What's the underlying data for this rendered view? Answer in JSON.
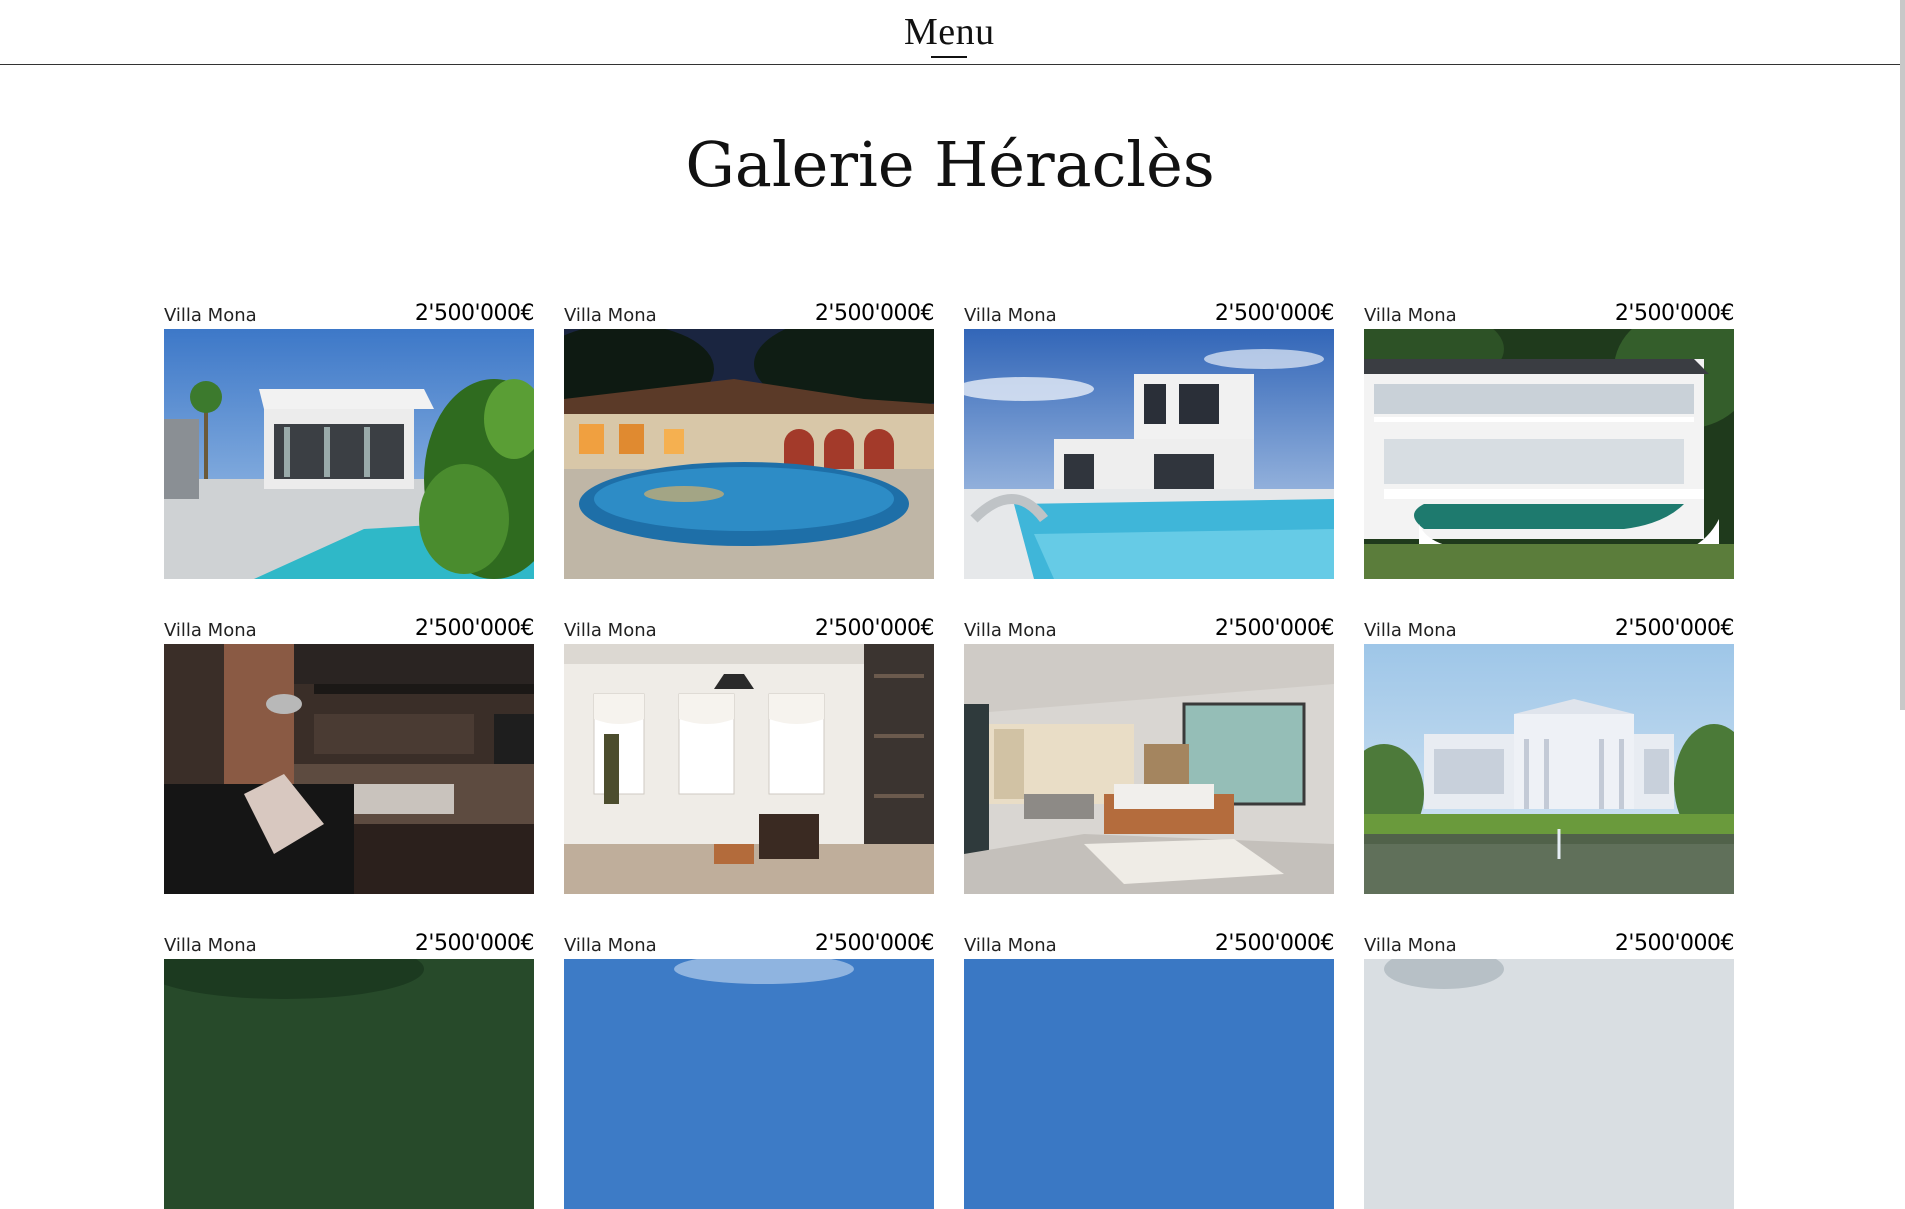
{
  "header": {
    "menu_label": "Menu"
  },
  "page": {
    "title": "Galerie Héraclès"
  },
  "cards": [
    {
      "name": "Villa Mona",
      "price": "2'500'000€",
      "scene": "modern-villa-pool"
    },
    {
      "name": "Villa Mona",
      "price": "2'500'000€",
      "scene": "night-courtyard-pool"
    },
    {
      "name": "Villa Mona",
      "price": "2'500'000€",
      "scene": "white-villa-pool"
    },
    {
      "name": "Villa Mona",
      "price": "2'500'000€",
      "scene": "terrace-villa-pool"
    },
    {
      "name": "Villa Mona",
      "price": "2'500'000€",
      "scene": "loft-living-room"
    },
    {
      "name": "Villa Mona",
      "price": "2'500'000€",
      "scene": "bright-living-room"
    },
    {
      "name": "Villa Mona",
      "price": "2'500'000€",
      "scene": "modern-bedroom"
    },
    {
      "name": "Villa Mona",
      "price": "2'500'000€",
      "scene": "classic-mansion-lake"
    },
    {
      "name": "Villa Mona",
      "price": "2'500'000€",
      "scene": "forest"
    },
    {
      "name": "Villa Mona",
      "price": "2'500'000€",
      "scene": "blue-sky"
    },
    {
      "name": "Villa Mona",
      "price": "2'500'000€",
      "scene": "blue-sky"
    },
    {
      "name": "Villa Mona",
      "price": "2'500'000€",
      "scene": "pale-sky"
    }
  ]
}
